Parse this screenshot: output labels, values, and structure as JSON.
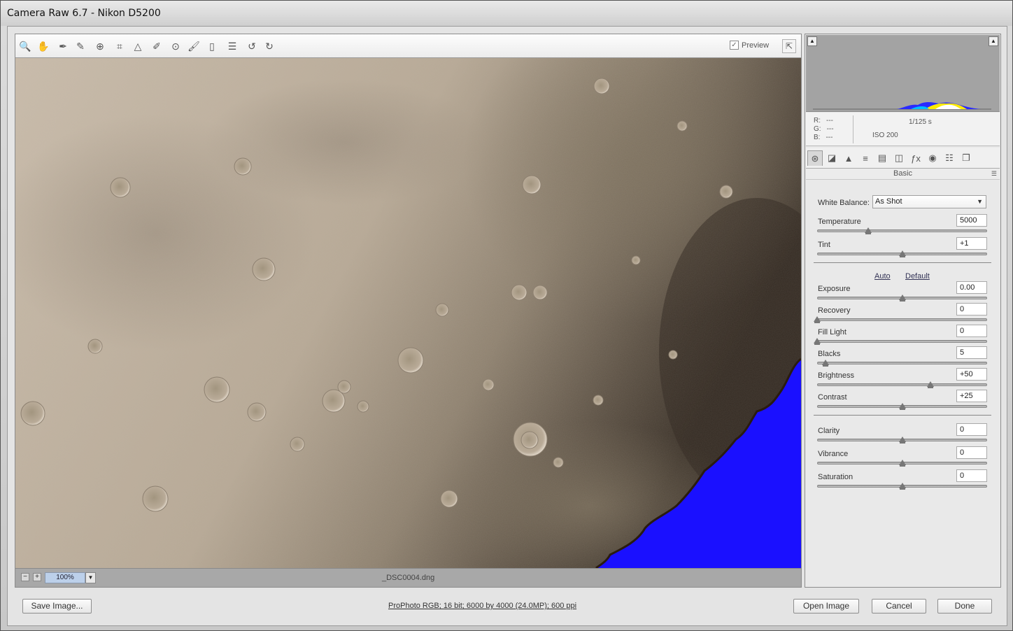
{
  "window": {
    "title": "Camera Raw 6.7  -  Nikon D5200"
  },
  "toolbar": {
    "tools": [
      "zoom-tool-icon",
      "hand-tool-icon",
      "white-balance-tool-icon",
      "color-sampler-tool-icon",
      "targeted-adjustment-tool-icon",
      "crop-tool-icon",
      "straighten-tool-icon",
      "spot-removal-tool-icon",
      "red-eye-removal-tool-icon",
      "adjustment-brush-icon",
      "graduated-filter-icon",
      "preferences-icon",
      "rotate-ccw-icon",
      "rotate-cw-icon"
    ],
    "preview_label": "Preview",
    "preview_checked": true
  },
  "status": {
    "zoom": "100%",
    "filename": "_DSC0004.dng"
  },
  "readout": {
    "r_label": "R:",
    "r_value": "---",
    "g_label": "G:",
    "g_value": "---",
    "b_label": "B:",
    "b_value": "---",
    "shutter": "1/125 s",
    "iso": "ISO 200"
  },
  "panel": {
    "title": "Basic",
    "tabs": [
      "basic-icon",
      "tone-curve-icon",
      "detail-icon",
      "hsl-icon",
      "split-toning-icon",
      "lens-corrections-icon",
      "effects-icon",
      "camera-calibration-icon",
      "presets-icon",
      "snapshots-icon"
    ],
    "white_balance_label": "White Balance:",
    "white_balance_value": "As Shot",
    "auto_label": "Auto",
    "default_label": "Default",
    "sliders": [
      {
        "label": "Temperature",
        "value": "5000",
        "pos": 0.3
      },
      {
        "label": "Tint",
        "value": "+1",
        "pos": 0.5
      },
      {
        "label": "Exposure",
        "value": "0.00",
        "pos": 0.5
      },
      {
        "label": "Recovery",
        "value": "0",
        "pos": 0.0
      },
      {
        "label": "Fill Light",
        "value": "0",
        "pos": 0.0
      },
      {
        "label": "Blacks",
        "value": "5",
        "pos": 0.05
      },
      {
        "label": "Brightness",
        "value": "+50",
        "pos": 0.665
      },
      {
        "label": "Contrast",
        "value": "+25",
        "pos": 0.5
      },
      {
        "label": "Clarity",
        "value": "0",
        "pos": 0.5
      },
      {
        "label": "Vibrance",
        "value": "0",
        "pos": 0.5
      },
      {
        "label": "Saturation",
        "value": "0",
        "pos": 0.5
      }
    ]
  },
  "footer": {
    "save_label": "Save Image...",
    "workflow_label": "ProPhoto RGB; 16 bit; 6000 by 4000 (24.0MP); 600 ppi",
    "open_label": "Open Image",
    "cancel_label": "Cancel",
    "done_label": "Done"
  },
  "colors": {
    "clipping_overlay": "#1a10ff",
    "moon_base": "#b8aa98"
  }
}
